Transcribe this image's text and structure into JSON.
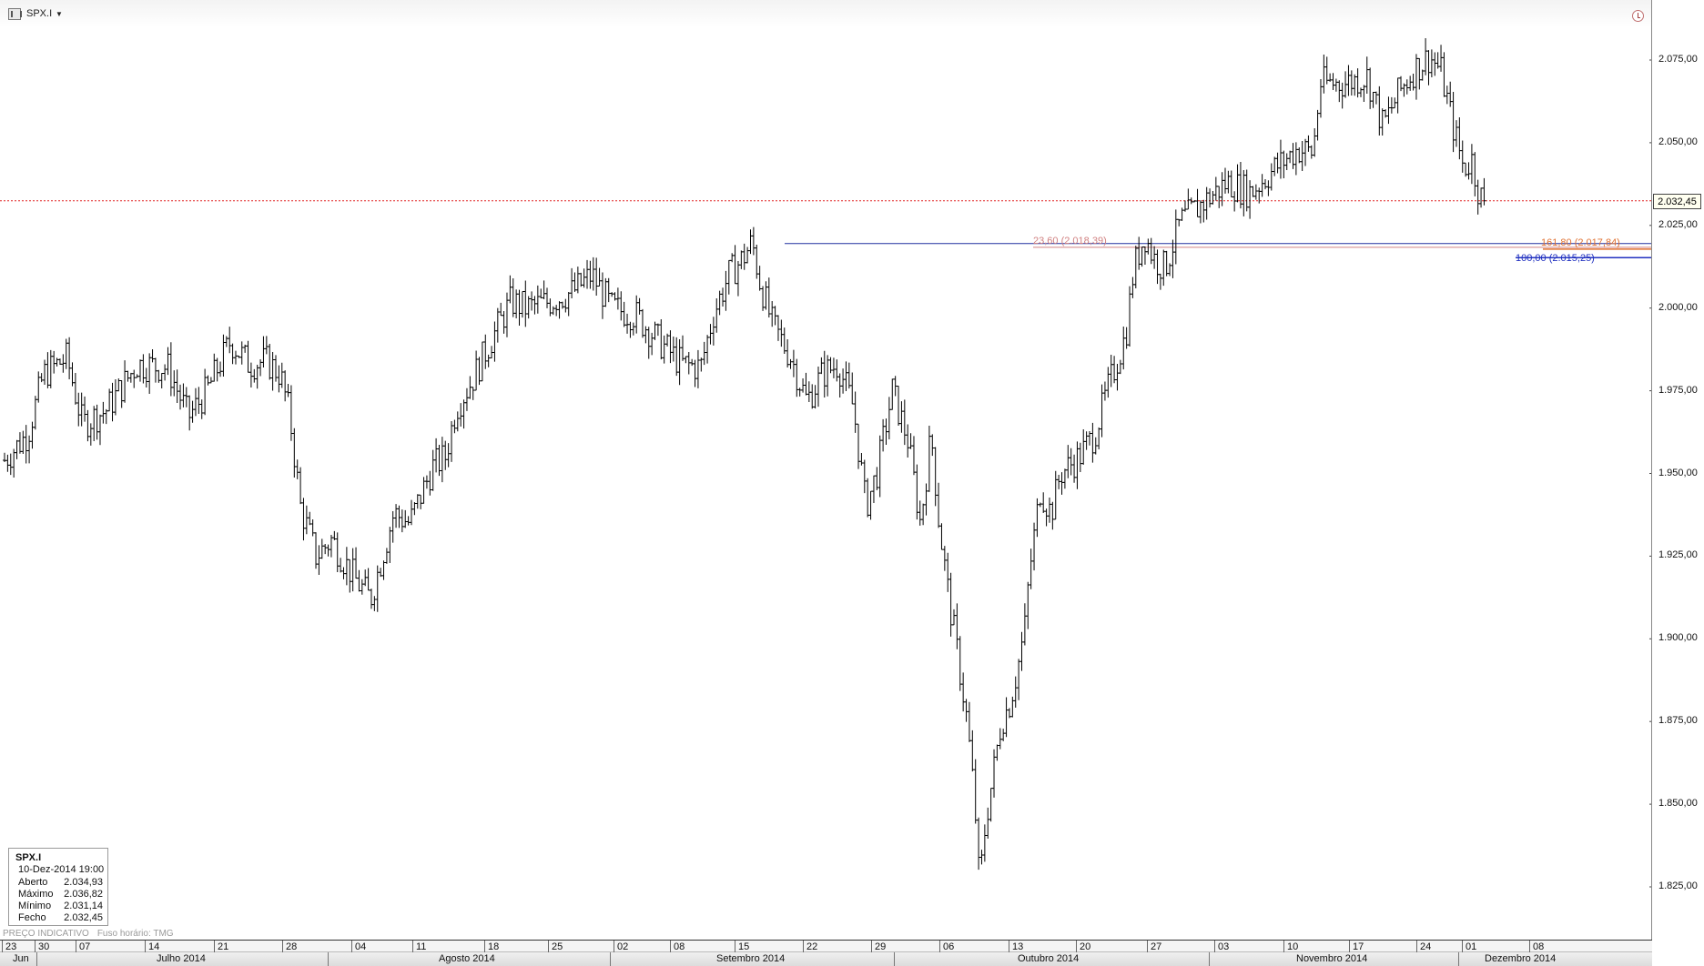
{
  "header": {
    "symbol": "SPX.I",
    "symbol_icon": "bar-chart-icon",
    "dropdown_icon": "chevron-down-icon",
    "clock_icon": "clock-icon"
  },
  "info_box": {
    "symbol": "SPX.I",
    "datetime": "10-Dez-2014 19:00",
    "rows": [
      {
        "label": "Aberto",
        "value": "2.034,93"
      },
      {
        "label": "Máximo",
        "value": "2.036,82"
      },
      {
        "label": "Mínimo",
        "value": "2.031,14"
      },
      {
        "label": "Fecho",
        "value": "2.032,45"
      }
    ]
  },
  "footnote": {
    "price_type": "PREÇO INDICATIVO",
    "timezone": "Fuso horário: TMG"
  },
  "colors": {
    "bars": "#000000",
    "last_price_line": "#e02020",
    "fib_23": "#d08080",
    "fib_161": "#e07030",
    "fib_100": "#2030c0",
    "swing_line": "#2030a0"
  },
  "chart_data": {
    "type": "bar",
    "subtype": "ohlc",
    "symbol": "SPX.I",
    "timeframe": "hourly",
    "y_axis_side": "right",
    "ylim": [
      1812,
      2086
    ],
    "yticks": [
      "2.075,00",
      "2.050,00",
      "2.025,00",
      "2.000,00",
      "1.975,00",
      "1.950,00",
      "1.925,00",
      "1.900,00",
      "1.875,00",
      "1.850,00",
      "1.825,00"
    ],
    "ytick_values": [
      2075,
      2050,
      2025,
      2000,
      1975,
      1950,
      1925,
      1900,
      1875,
      1850,
      1825
    ],
    "last_price": 2032.45,
    "last_price_label": "2.032,45",
    "grid": false,
    "x_ticks": [
      "23",
      "30",
      "07",
      "14",
      "21",
      "28",
      "04",
      "11",
      "18",
      "25",
      "02",
      "08",
      "15",
      "22",
      "29",
      "06",
      "13",
      "20",
      "27",
      "03",
      "10",
      "17",
      "24",
      "01",
      "08"
    ],
    "months": [
      "Jun",
      "Julho 2014",
      "Agosto 2014",
      "Setembro 2014",
      "Outubro 2014",
      "Novembro 2014",
      "Dezembro 2014"
    ],
    "price_path": [
      [
        0,
        1954
      ],
      [
        0.015,
        1962
      ],
      [
        0.025,
        1980
      ],
      [
        0.04,
        1985
      ],
      [
        0.05,
        1965
      ],
      [
        0.065,
        1969
      ],
      [
        0.085,
        1983
      ],
      [
        0.105,
        1982
      ],
      [
        0.118,
        1967
      ],
      [
        0.13,
        1975
      ],
      [
        0.145,
        1990
      ],
      [
        0.157,
        1983
      ],
      [
        0.168,
        1984
      ],
      [
        0.177,
        1980
      ],
      [
        0.183,
        1968
      ],
      [
        0.19,
        1940
      ],
      [
        0.2,
        1925
      ],
      [
        0.21,
        1930
      ],
      [
        0.225,
        1918
      ],
      [
        0.235,
        1912
      ],
      [
        0.25,
        1938
      ],
      [
        0.26,
        1935
      ],
      [
        0.275,
        1952
      ],
      [
        0.283,
        1955
      ],
      [
        0.29,
        1970
      ],
      [
        0.3,
        1978
      ],
      [
        0.312,
        1990
      ],
      [
        0.325,
        2002
      ],
      [
        0.335,
        2000
      ],
      [
        0.35,
        2002
      ],
      [
        0.365,
        2005
      ],
      [
        0.377,
        2010
      ],
      [
        0.39,
        2000
      ],
      [
        0.405,
        1998
      ],
      [
        0.42,
        1990
      ],
      [
        0.435,
        1983
      ],
      [
        0.447,
        1982
      ],
      [
        0.455,
        1998
      ],
      [
        0.465,
        2010
      ],
      [
        0.474,
        2015
      ],
      [
        0.48,
        2020
      ],
      [
        0.485,
        2008
      ],
      [
        0.493,
        1995
      ],
      [
        0.505,
        1985
      ],
      [
        0.515,
        1972
      ],
      [
        0.525,
        1980
      ],
      [
        0.535,
        1983
      ],
      [
        0.545,
        1970
      ],
      [
        0.553,
        1940
      ],
      [
        0.56,
        1950
      ],
      [
        0.57,
        1975
      ],
      [
        0.58,
        1960
      ],
      [
        0.588,
        1935
      ],
      [
        0.595,
        1962
      ],
      [
        0.6,
        1935
      ],
      [
        0.607,
        1910
      ],
      [
        0.612,
        1895
      ],
      [
        0.618,
        1875
      ],
      [
        0.623,
        1850
      ],
      [
        0.626,
        1825
      ],
      [
        0.63,
        1845
      ],
      [
        0.635,
        1860
      ],
      [
        0.64,
        1875
      ],
      [
        0.645,
        1880
      ],
      [
        0.65,
        1890
      ],
      [
        0.655,
        1903
      ],
      [
        0.658,
        1920
      ],
      [
        0.665,
        1945
      ],
      [
        0.672,
        1938
      ],
      [
        0.678,
        1950
      ],
      [
        0.69,
        1955
      ],
      [
        0.7,
        1962
      ],
      [
        0.708,
        1975
      ],
      [
        0.715,
        1985
      ],
      [
        0.72,
        1992
      ],
      [
        0.725,
        2012
      ],
      [
        0.732,
        2022
      ],
      [
        0.738,
        2015
      ],
      [
        0.745,
        2012
      ],
      [
        0.755,
        2026
      ],
      [
        0.77,
        2032
      ],
      [
        0.785,
        2038
      ],
      [
        0.8,
        2035
      ],
      [
        0.815,
        2042
      ],
      [
        0.83,
        2048
      ],
      [
        0.84,
        2047
      ],
      [
        0.845,
        2068
      ],
      [
        0.86,
        2068
      ],
      [
        0.875,
        2070
      ],
      [
        0.885,
        2055
      ],
      [
        0.895,
        2065
      ],
      [
        0.905,
        2072
      ],
      [
        0.915,
        2076
      ],
      [
        0.922,
        2072
      ],
      [
        0.93,
        2055
      ],
      [
        0.937,
        2042
      ],
      [
        0.942,
        2045
      ],
      [
        0.947,
        2034
      ],
      [
        0.95,
        2032.45
      ]
    ],
    "annotations": [
      {
        "text": "23,60 (2.018,39)",
        "value": 2018.39
      },
      {
        "text": "161,80 (2.017,84)",
        "value": 2017.84
      },
      {
        "text": "100,00 (2.015,25)",
        "value": 2015.25
      }
    ],
    "swing_high": 2019.5
  }
}
